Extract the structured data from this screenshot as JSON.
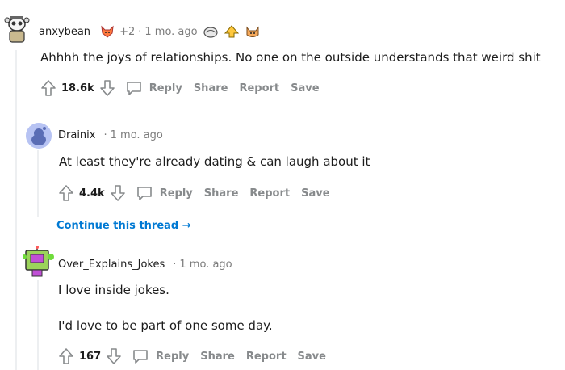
{
  "comments": [
    {
      "username": "anxybean",
      "award_count": "+2",
      "time": "1 mo. ago",
      "text": "Ahhhh the joys of relationships. No one on the outside understands that weird shit",
      "score": "18.6k"
    },
    {
      "username": "Drainix",
      "time": "1 mo. ago",
      "text": "At least they're already dating & can laugh about it",
      "score": "4.4k"
    },
    {
      "username": "Over_Explains_Jokes",
      "time": "1 mo. ago",
      "text_line1": "I love inside jokes.",
      "text_line2": "I'd love to be part of one some day.",
      "score": "167"
    }
  ],
  "actions": {
    "reply": "Reply",
    "share": "Share",
    "report": "Report",
    "save": "Save"
  },
  "continue_thread": "Continue this thread",
  "colors": {
    "link_blue": "#0079d3",
    "muted_text": "#878a8c",
    "thread_line": "#edeff1"
  }
}
